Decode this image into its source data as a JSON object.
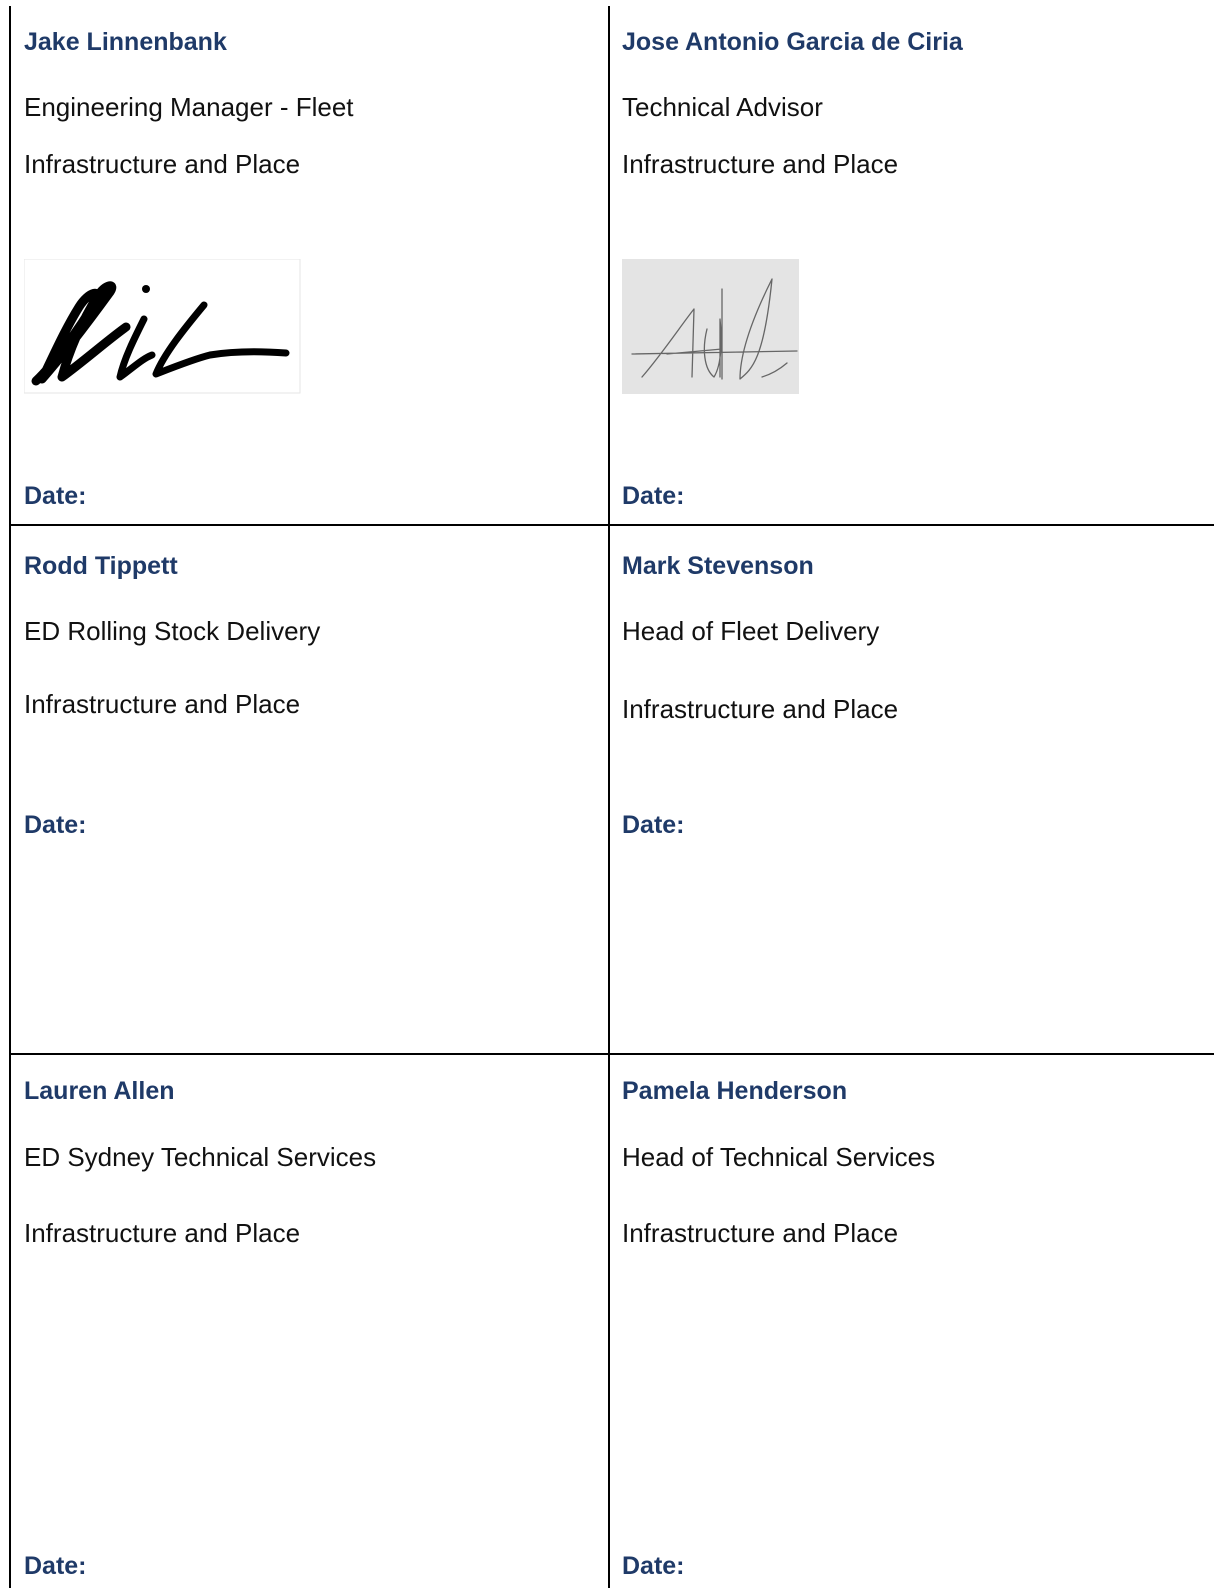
{
  "signatories": [
    {
      "name": "Jake Linnenbank",
      "title": "Engineering Manager - Fleet",
      "department": "Infrastructure and Place",
      "date_label": "Date:",
      "signature": "handwritten-signature-jl"
    },
    {
      "name": "Jose Antonio Garcia de Ciria",
      "title": "Technical Advisor",
      "department": "Infrastructure and Place",
      "date_label": "Date:",
      "signature": "handwritten-signature-jagc"
    },
    {
      "name": "Rodd Tippett",
      "title": "ED Rolling Stock Delivery",
      "department": "Infrastructure and Place",
      "date_label": "Date:"
    },
    {
      "name": "Mark Stevenson",
      "title": "Head of Fleet Delivery",
      "department": "Infrastructure and Place",
      "date_label": "Date:"
    },
    {
      "name": "Lauren Allen",
      "title": "ED Sydney Technical Services",
      "department": "Infrastructure and Place",
      "date_label": "Date:"
    },
    {
      "name": "Pamela Henderson",
      "title": "Head of Technical Services",
      "department": "Infrastructure and Place",
      "date_label": "Date:"
    }
  ],
  "colors": {
    "heading": "#1f3a68",
    "text": "#111111",
    "border": "#000000"
  }
}
